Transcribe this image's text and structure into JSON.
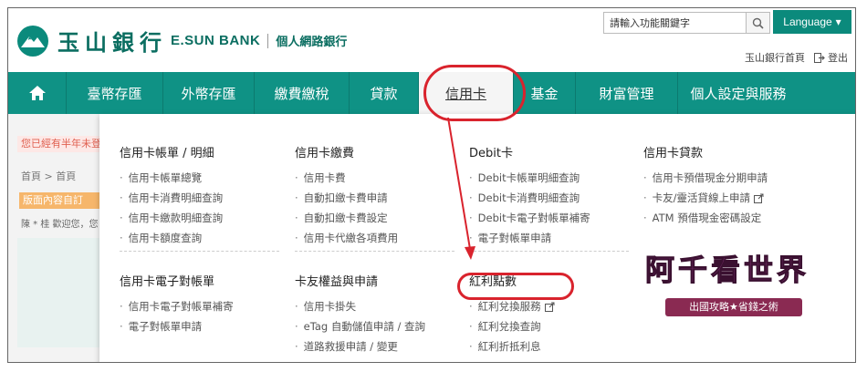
{
  "header": {
    "logo_cn": "玉山銀行",
    "logo_en": "E.SUN BANK",
    "logo_sub": "個人網路銀行",
    "search_placeholder": "請輸入功能關鍵字",
    "language_label": "Language",
    "home_link": "玉山銀行首頁",
    "logout_link": "登出"
  },
  "nav": {
    "items": [
      "臺幣存匯",
      "外幣存匯",
      "繳費繳稅",
      "貸款",
      "信用卡",
      "基金",
      "財富管理",
      "個人設定與服務"
    ]
  },
  "background": {
    "banner": "您已經有半年未登入",
    "breadcrumb": "首頁 > 首頁",
    "tag": "版面內容自訂",
    "user": "陳 * 桂 歡迎您，您"
  },
  "dropdown": {
    "col1": {
      "h1": "信用卡帳單 / 明細",
      "items1": [
        "信用卡帳單總覽",
        "信用卡消費明細查詢",
        "信用卡繳款明細查詢",
        "信用卡額度查詢"
      ],
      "h2": "信用卡電子對帳單",
      "items2": [
        "信用卡電子對帳單補寄",
        "電子對帳單申請"
      ]
    },
    "col2": {
      "h1": "信用卡繳費",
      "items1": [
        "信用卡費",
        "自動扣繳卡費申請",
        "自動扣繳卡費設定",
        "信用卡代繳各項費用"
      ],
      "h2": "卡友權益與申請",
      "items2": [
        "信用卡掛失",
        "eTag 自動儲值申請 / 查詢",
        "道路救援申請 / 變更"
      ]
    },
    "col3": {
      "h1": "Debit卡",
      "items1": [
        "Debit卡帳單明細查詢",
        "Debit卡消費明細查詢",
        "Debit卡電子對帳單補寄",
        "電子對帳單申請"
      ],
      "h2": "紅利點數",
      "items2": [
        "紅利兌換服務",
        "紅利兌換查詢",
        "紅利折抵利息"
      ]
    },
    "col4": {
      "h1": "信用卡貸款",
      "items1": [
        "信用卡預借現金分期申請",
        "卡友/靈活貸線上申請",
        "ATM 預借現金密碼設定"
      ]
    }
  },
  "watermark": {
    "title": "阿千看世界",
    "ribbon": "出國攻略★省錢之術"
  },
  "colors": {
    "brand": "#0f9285",
    "annotation": "#d9232d"
  }
}
